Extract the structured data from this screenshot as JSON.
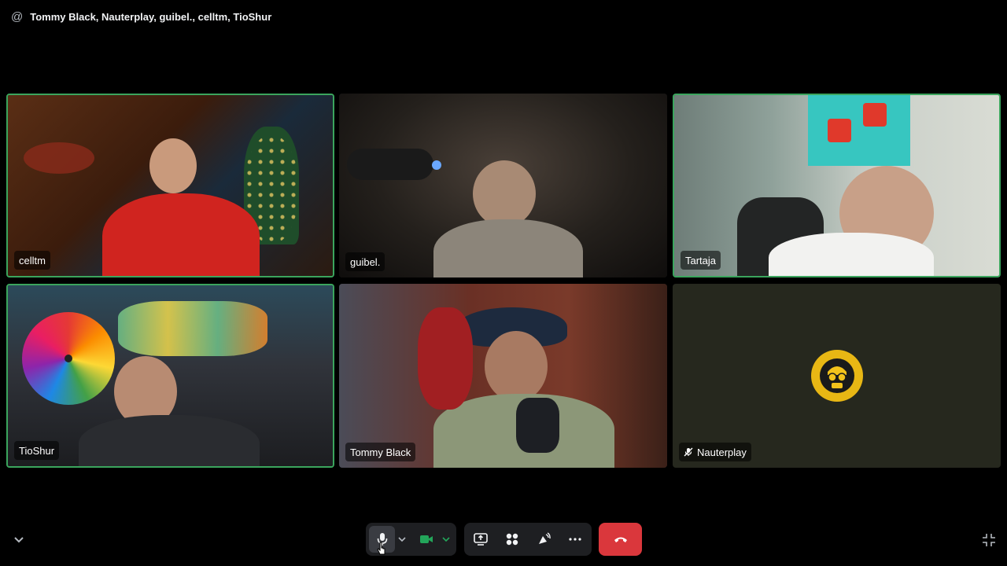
{
  "header": {
    "icon": "at-icon",
    "title": "Tommy Black, Nauterplay, guibel., celltm, TioShur"
  },
  "participants": [
    {
      "name": "celltm",
      "speaking": true,
      "muted": false,
      "video": true
    },
    {
      "name": "guibel.",
      "speaking": false,
      "muted": false,
      "video": true
    },
    {
      "name": "Tartaja",
      "speaking": true,
      "muted": false,
      "video": true
    },
    {
      "name": "TioShur",
      "speaking": true,
      "muted": false,
      "video": true
    },
    {
      "name": "Tommy Black",
      "speaking": false,
      "muted": false,
      "video": true
    },
    {
      "name": "Nauterplay",
      "speaking": false,
      "muted": true,
      "video": false,
      "avatar_color": "#e8b714"
    }
  ],
  "controls": {
    "microphone": {
      "icon": "microphone-icon",
      "state": "on"
    },
    "camera": {
      "icon": "camera-icon",
      "state": "on",
      "color": "#23a55a"
    },
    "share_screen": {
      "icon": "share-screen-icon"
    },
    "activities": {
      "icon": "activities-icon"
    },
    "soundboard": {
      "icon": "soundboard-icon"
    },
    "more": {
      "icon": "more-icon"
    },
    "leave": {
      "icon": "phone-hangup-icon",
      "color": "#da373c"
    },
    "fullscreen": {
      "icon": "exit-fullscreen-icon"
    },
    "collapse": {
      "icon": "chevron-down-icon"
    }
  },
  "colors": {
    "background": "#000000",
    "speaking_border": "#3ba55d",
    "leave_button": "#da373c",
    "camera_active": "#23a55a"
  }
}
